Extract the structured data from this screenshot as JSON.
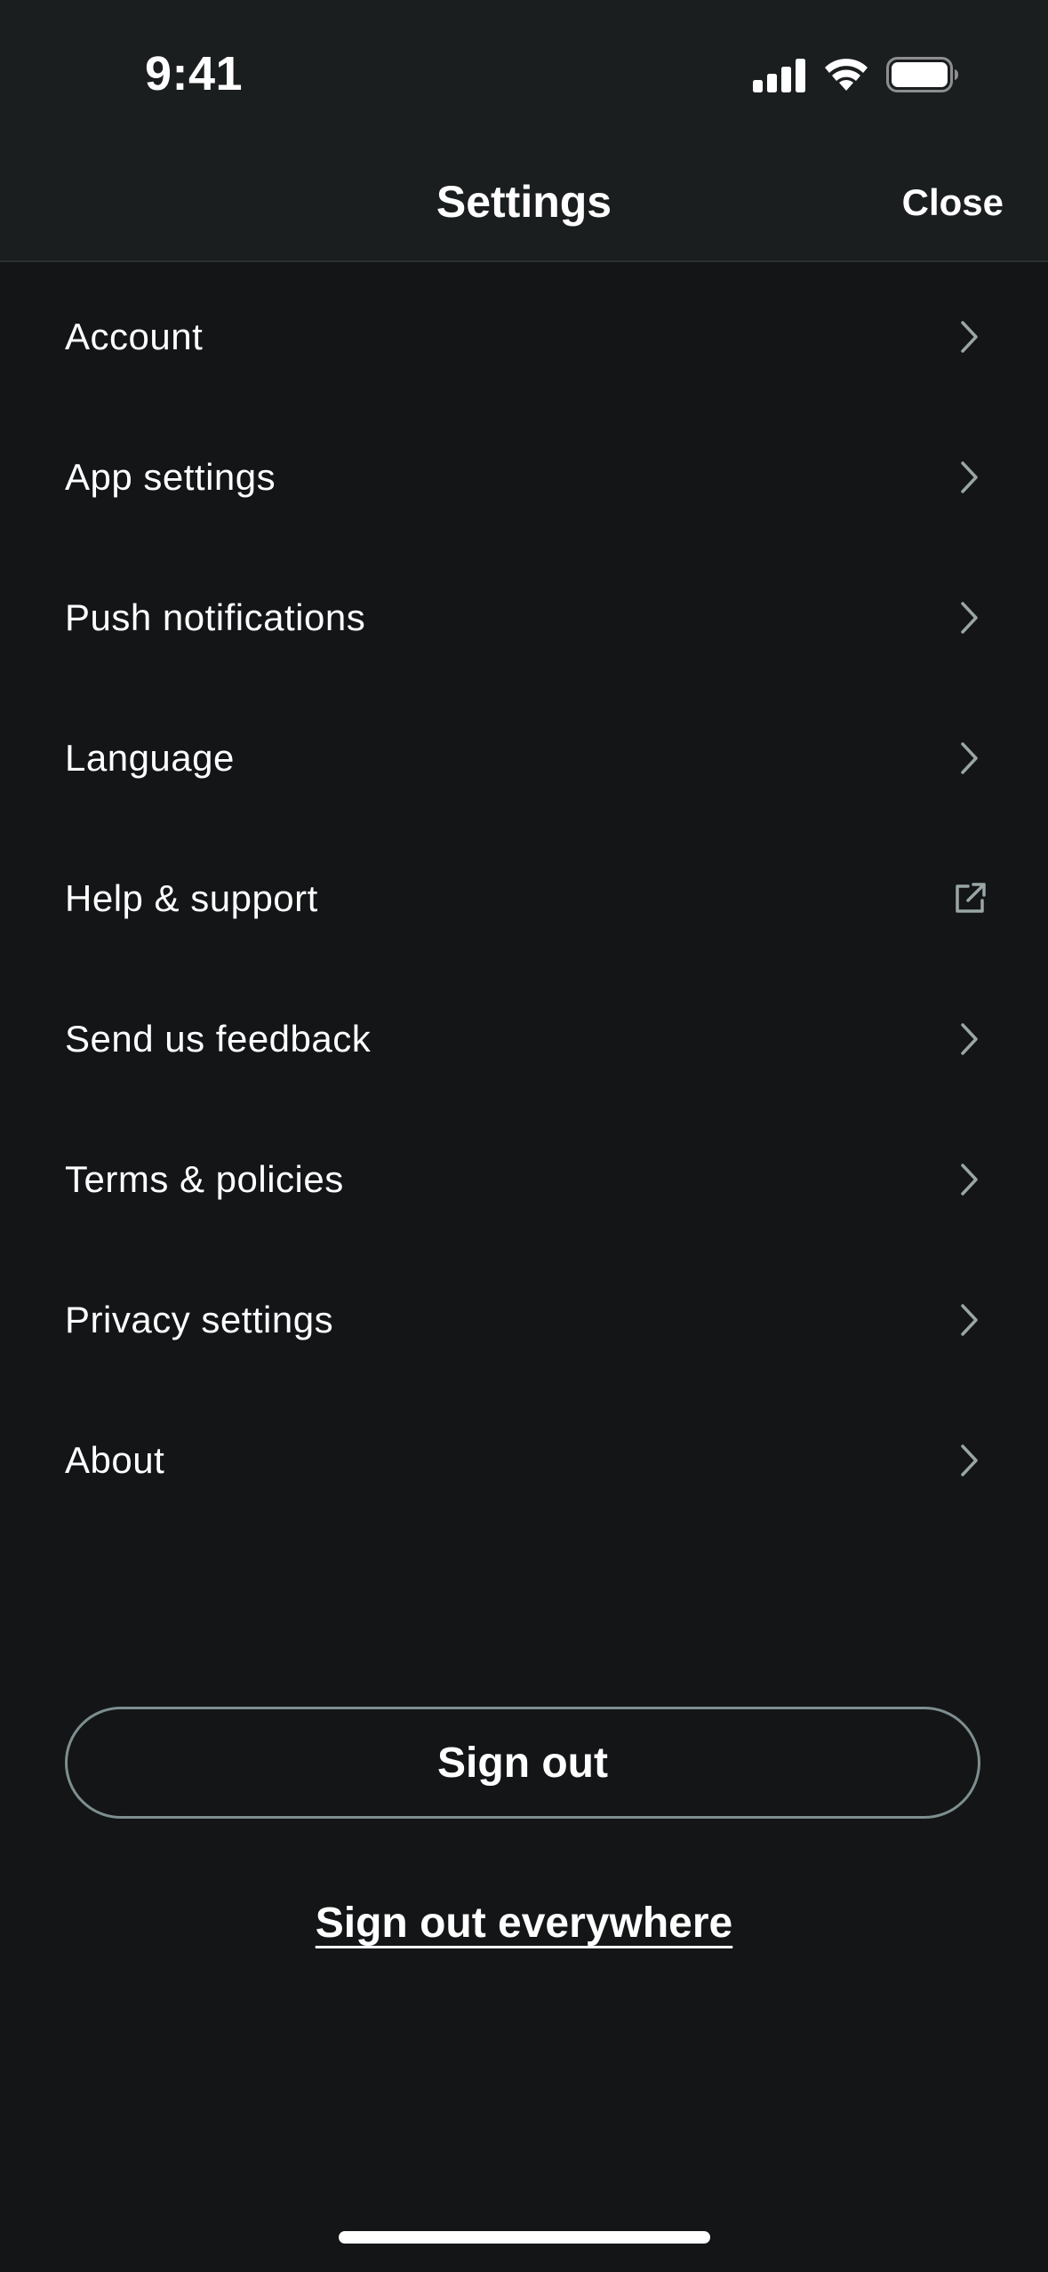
{
  "status_bar": {
    "time": "9:41"
  },
  "header": {
    "title": "Settings",
    "close_label": "Close"
  },
  "menu": {
    "items": [
      {
        "label": "Account",
        "icon": "chevron-right-icon"
      },
      {
        "label": "App settings",
        "icon": "chevron-right-icon"
      },
      {
        "label": "Push notifications",
        "icon": "chevron-right-icon"
      },
      {
        "label": "Language",
        "icon": "chevron-right-icon"
      },
      {
        "label": "Help & support",
        "icon": "external-link-icon"
      },
      {
        "label": "Send us feedback",
        "icon": "chevron-right-icon"
      },
      {
        "label": "Terms & policies",
        "icon": "chevron-right-icon"
      },
      {
        "label": "Privacy settings",
        "icon": "chevron-right-icon"
      },
      {
        "label": "About",
        "icon": "chevron-right-icon"
      }
    ]
  },
  "actions": {
    "sign_out": "Sign out",
    "sign_out_everywhere": "Sign out everywhere"
  },
  "colors": {
    "background": "#131517",
    "header_background": "#1a1e1f",
    "icon_gray": "#9aa5a6",
    "button_border": "#7e8e8f"
  }
}
